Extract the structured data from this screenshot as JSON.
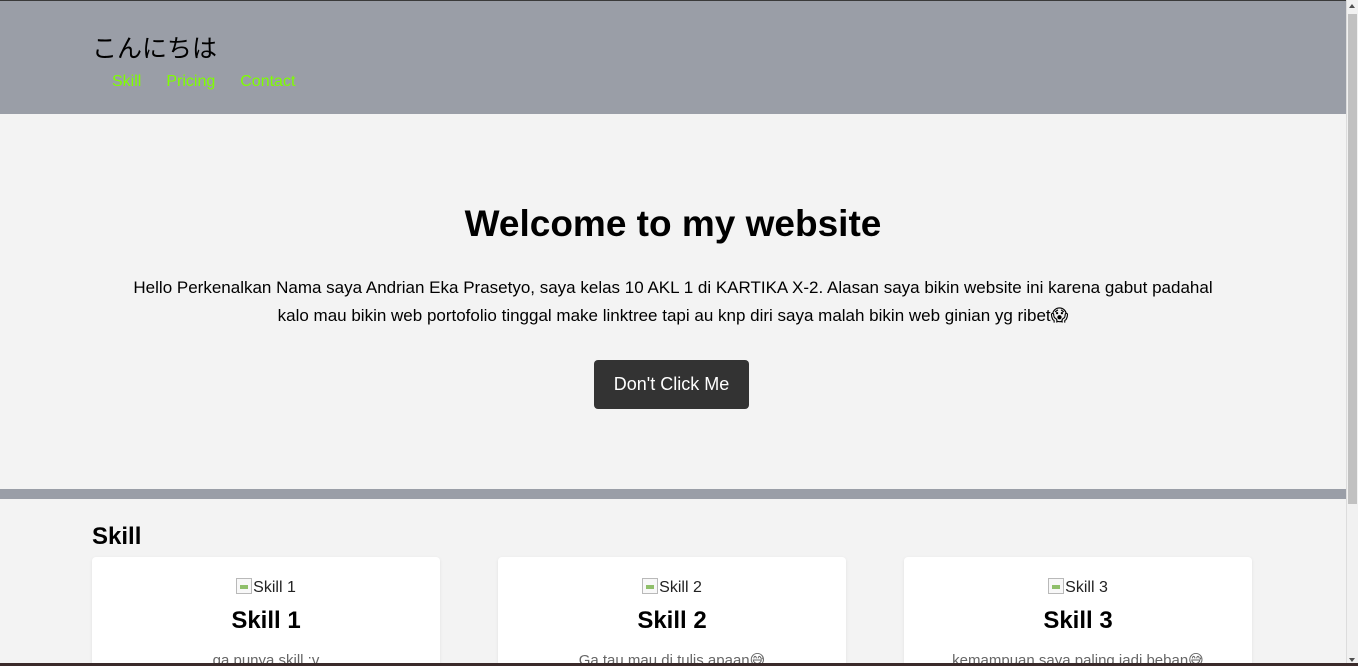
{
  "header": {
    "site_title": "こんにちは",
    "nav": [
      "Skill",
      "Pricing",
      "Contact"
    ]
  },
  "hero": {
    "title": "Welcome to my website",
    "text_line1": "Hello Perkenalkan Nama saya Andrian Eka Prasetyo, saya kelas 10 AKL 1 di KARTIKA X-2. Alasan saya bikin website ini karena gabut padahal",
    "text_line2": "kalo mau bikin web portofolio tinggal make linktree tapi au knp diri saya malah bikin web ginian yg ribet😱",
    "button_label": "Don't Click Me"
  },
  "skill_section": {
    "title": "Skill",
    "cards": [
      {
        "img_alt": "Skill 1",
        "title": "Skill 1",
        "desc": "ga punya skill :v"
      },
      {
        "img_alt": "Skill 2",
        "title": "Skill 2",
        "desc": "Ga tau mau di tulis apaan😅"
      },
      {
        "img_alt": "Skill 3",
        "title": "Skill 3",
        "desc": "kemampuan saya paling jadi beban😅"
      }
    ]
  },
  "colors": {
    "header_bg": "#9a9ea7",
    "nav_link": "#7fff00",
    "page_bg": "#f3f3f3",
    "button_bg": "#333333"
  }
}
